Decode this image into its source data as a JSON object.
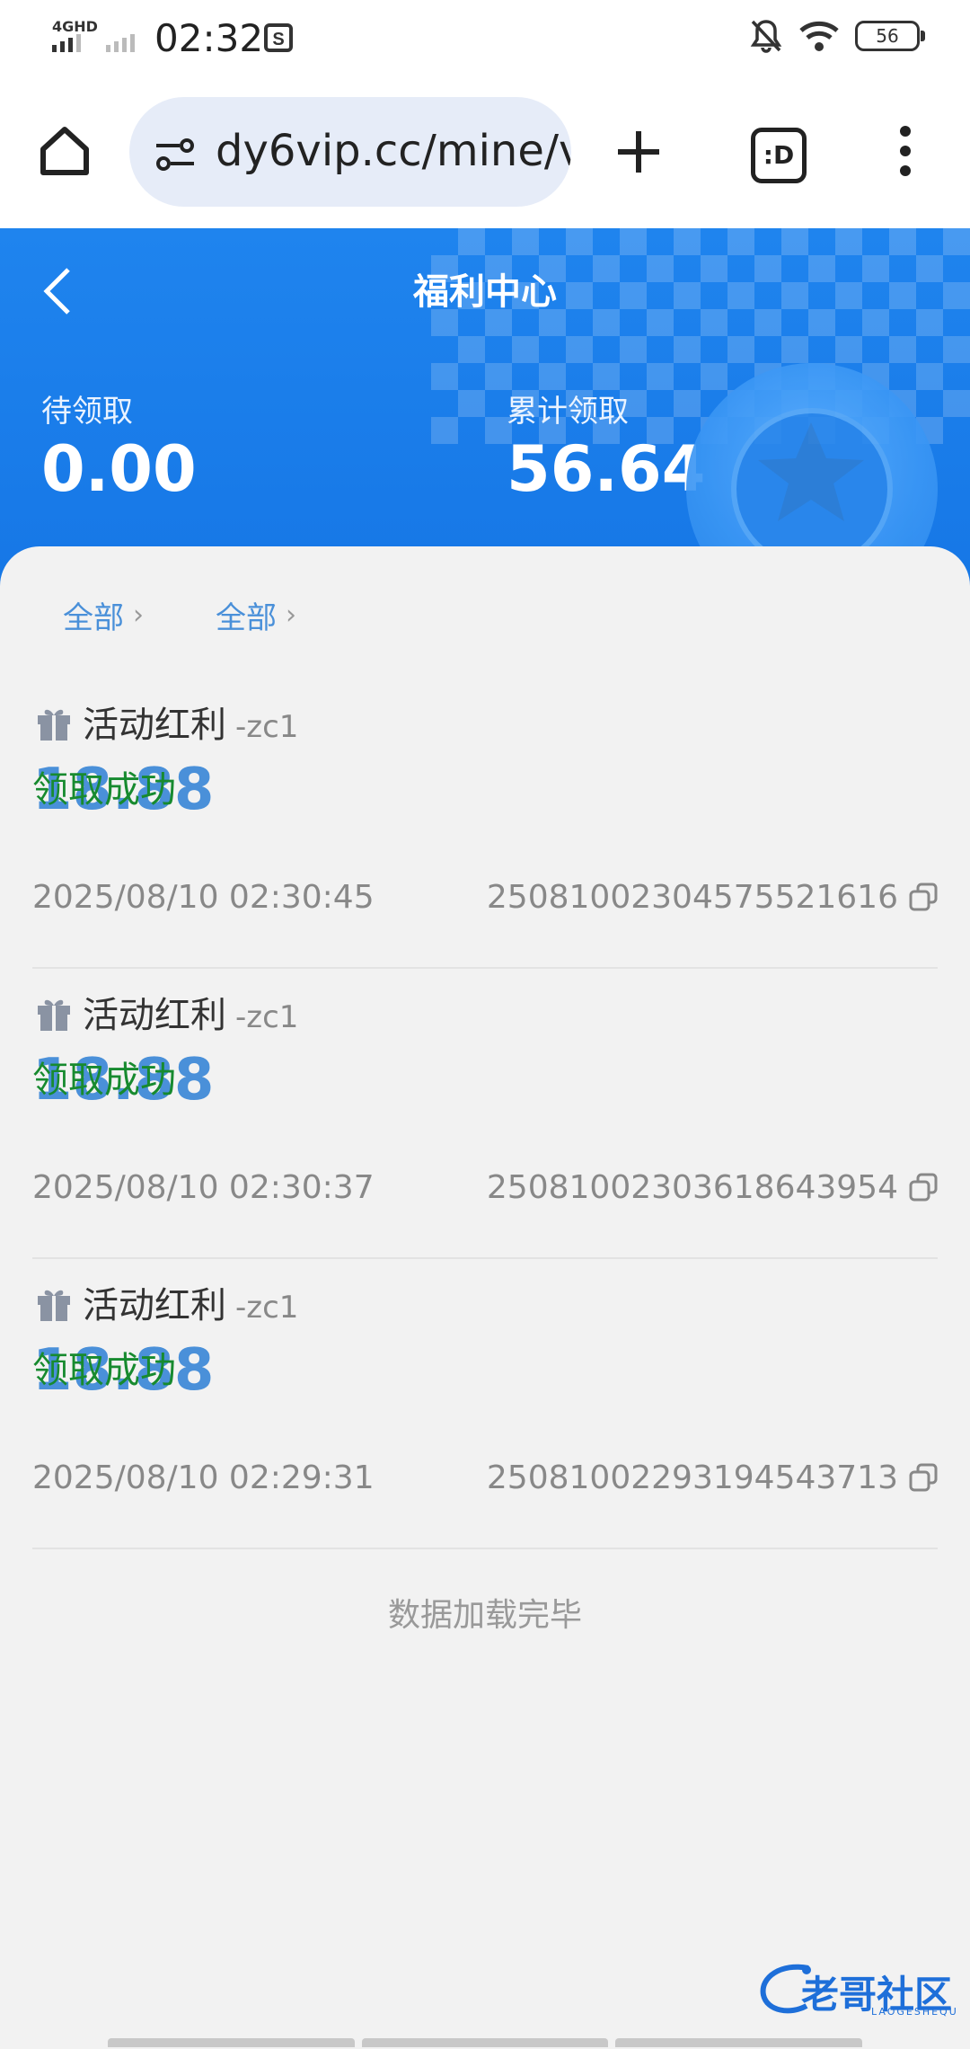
{
  "status_bar": {
    "network": "4GHD",
    "time": "02:32",
    "battery": "56"
  },
  "browser": {
    "url": "dy6vip.cc/mine/v",
    "tab_label": ":D"
  },
  "header": {
    "title": "福利中心",
    "pending_label": "待领取",
    "pending_value": "0.00",
    "total_label": "累计领取",
    "total_value": "56.64"
  },
  "filters": [
    {
      "label": "全部"
    },
    {
      "label": "全部"
    }
  ],
  "records": [
    {
      "name": "活动红利",
      "tag": "-zc1",
      "amount": "18.88",
      "status": "领取成功",
      "datetime": "2025/08/10 02:30:45",
      "order_id": "25081002304575521616"
    },
    {
      "name": "活动红利",
      "tag": "-zc1",
      "amount": "18.88",
      "status": "领取成功",
      "datetime": "2025/08/10 02:30:37",
      "order_id": "25081002303618643954"
    },
    {
      "name": "活动红利",
      "tag": "-zc1",
      "amount": "18.88",
      "status": "领取成功",
      "datetime": "2025/08/10 02:29:31",
      "order_id": "25081002293194543713"
    }
  ],
  "footer": {
    "loaded_text": "数据加载完毕"
  },
  "watermark": {
    "text": "老哥社区",
    "sub": "LAOGESHEQU"
  },
  "colors": {
    "accent_blue": "#1677e6",
    "amount_blue": "#4a90d9",
    "success_green": "#178a2f"
  }
}
